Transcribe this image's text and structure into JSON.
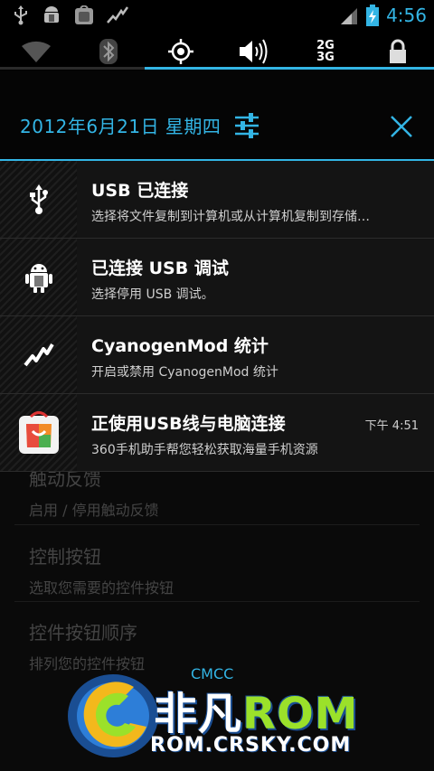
{
  "status_bar": {
    "clock": "4:56",
    "left_icons": [
      "usb-icon",
      "android-debug-icon",
      "store-app-icon",
      "stats-icon"
    ],
    "right_icons": [
      "signal-icon",
      "battery-charging-icon"
    ]
  },
  "quick_toggles": [
    {
      "name": "wifi",
      "icon": "wifi-icon",
      "active": false
    },
    {
      "name": "bluetooth",
      "icon": "bluetooth-icon",
      "active": false
    },
    {
      "name": "gps",
      "icon": "gps-icon",
      "active": true
    },
    {
      "name": "sound",
      "icon": "sound-icon",
      "active": true
    },
    {
      "name": "network-mode",
      "icon": "2g3g-icon",
      "label_top": "2G",
      "label_bottom": "3G",
      "active": true
    },
    {
      "name": "lock",
      "icon": "lock-icon",
      "active": false
    }
  ],
  "header": {
    "date": "2012年6月21日 星期四"
  },
  "notifications": [
    {
      "icon": "usb-icon",
      "title": "USB 已连接",
      "subtitle": "选择将文件复制到计算机或从计算机复制到存储…",
      "time": ""
    },
    {
      "icon": "android-debug-icon",
      "title": "已连接 USB 调试",
      "subtitle": "选择停用 USB 调试。",
      "time": ""
    },
    {
      "icon": "stats-icon",
      "title": "CyanogenMod 统计",
      "subtitle": "开启或禁用 CyanogenMod 统计",
      "time": ""
    },
    {
      "icon": "store-app-icon",
      "title": "正使用USB线与电脑连接",
      "subtitle": "360手机助手帮您轻松获取海量手机资源",
      "time": "下午 4:51"
    }
  ],
  "background_settings": [
    {
      "title": "触动反馈",
      "subtitle": "启用 / 停用触动反馈"
    },
    {
      "title": "控制按钮",
      "subtitle": "选取您需要的控件按钮"
    },
    {
      "title": "控件按钮顺序",
      "subtitle": "排列您的控件按钮"
    }
  ],
  "carrier": "CMCC",
  "watermark": {
    "brand_cn": "非凡",
    "brand_en": "ROM",
    "url": "ROM.CRSKY.COM"
  },
  "colors": {
    "accent": "#33b5e5",
    "background": "#000000",
    "panel": "#141414",
    "watermark_green": "#9be12a",
    "watermark_blue": "#1a4e93"
  }
}
